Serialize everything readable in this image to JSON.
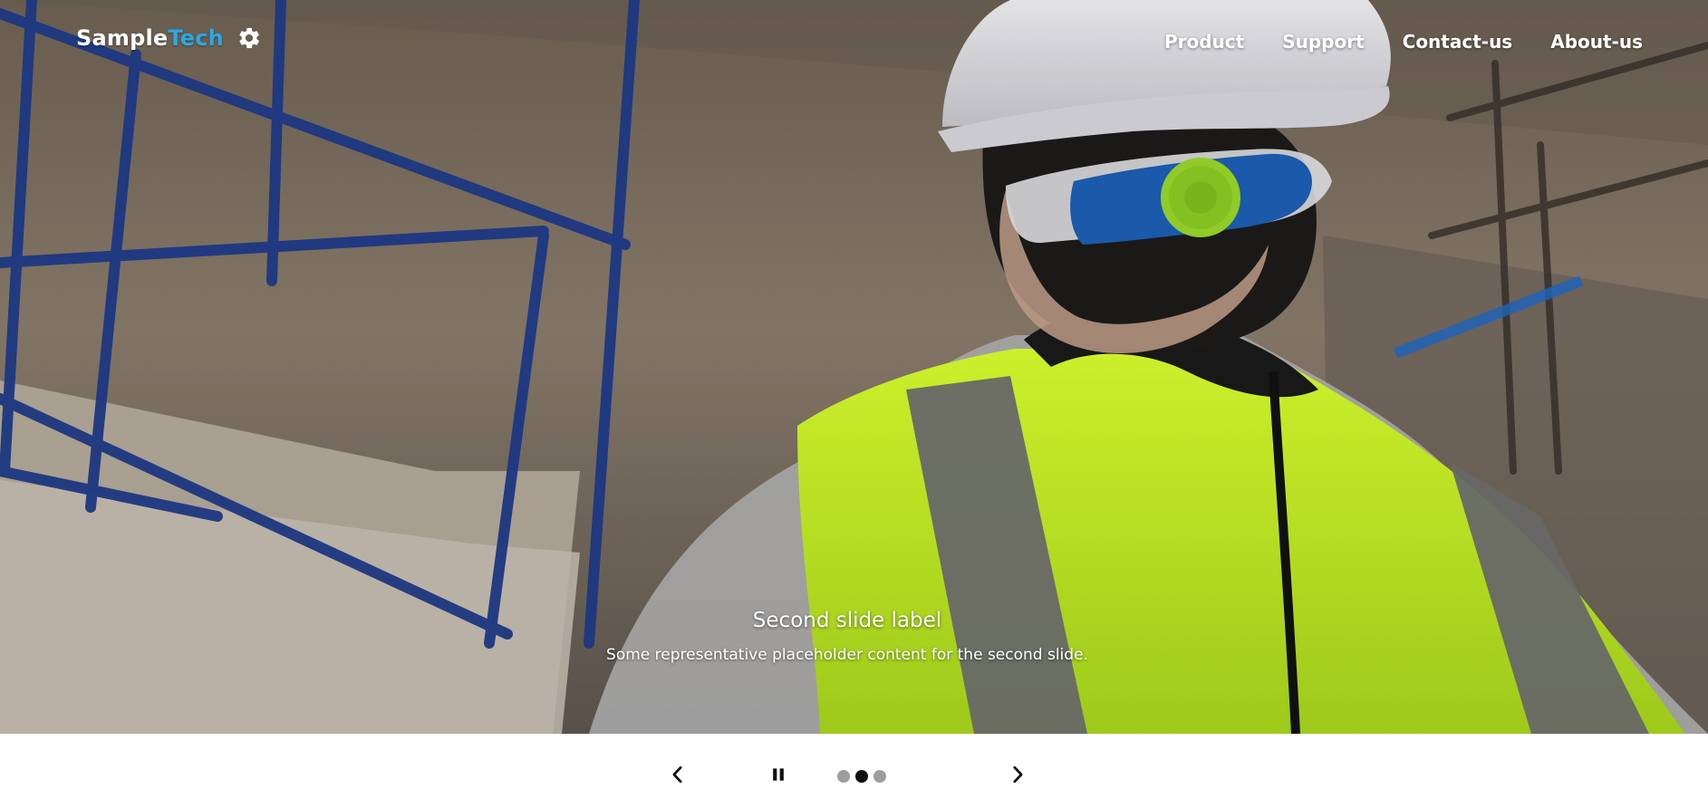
{
  "brand": {
    "name_part1": "Sample",
    "name_part2": "Tech",
    "icon": "gear-icon",
    "accent_color": "#2aa8e8"
  },
  "nav": {
    "items": [
      {
        "label": "Product"
      },
      {
        "label": "Support"
      },
      {
        "label": "Contact-us"
      },
      {
        "label": "About-us"
      }
    ]
  },
  "carousel": {
    "active_index": 1,
    "slide_count": 3,
    "caption": {
      "title": "Second slide label",
      "text": "Some representative placeholder content for the second slide."
    },
    "controls": {
      "prev_icon": "chevron-left-icon",
      "pause_icon": "pause-icon",
      "next_icon": "chevron-right-icon"
    }
  }
}
